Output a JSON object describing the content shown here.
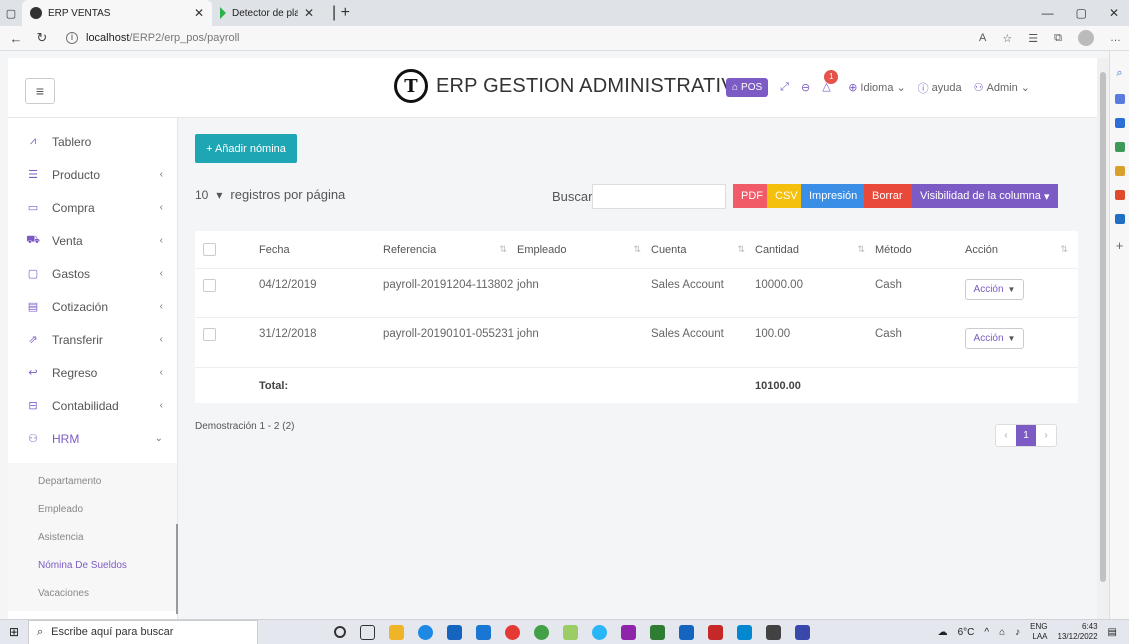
{
  "browser": {
    "tabs": [
      {
        "title": "ERP VENTAS",
        "active": true
      },
      {
        "title": "Detector de plagio -",
        "active": false
      }
    ],
    "url_host": "localhost",
    "url_path": "/ERP2/erp_pos/payroll"
  },
  "header": {
    "brand_title": "ERP GESTION ADMINISTRATIVA",
    "pos_label": "POS",
    "notif_count": "1",
    "language_label": "Idioma",
    "help_label": "ayuda",
    "user_label": "Admin"
  },
  "sidebar": {
    "items": [
      {
        "label": "Tablero",
        "icon": "dashboard-icon"
      },
      {
        "label": "Producto",
        "icon": "list-icon"
      },
      {
        "label": "Compra",
        "icon": "card-icon"
      },
      {
        "label": "Venta",
        "icon": "cart-icon"
      },
      {
        "label": "Gastos",
        "icon": "wallet-icon"
      },
      {
        "label": "Cotización",
        "icon": "document-icon"
      },
      {
        "label": "Transferir",
        "icon": "share-icon"
      },
      {
        "label": "Regreso",
        "icon": "return-icon"
      },
      {
        "label": "Contabilidad",
        "icon": "briefcase-icon"
      },
      {
        "label": "HRM",
        "icon": "users-icon"
      }
    ],
    "submenu": [
      "Departamento",
      "Empleado",
      "Asistencia",
      "Nómina De Sueldos",
      "Vacaciones"
    ],
    "active_sub": "Nómina De Sueldos"
  },
  "main": {
    "add_button": "+ Añadir nómina",
    "page_length": "10",
    "page_length_label": "registros por página",
    "search_label": "Buscar",
    "search_value": "",
    "buttons": {
      "pdf": "PDF",
      "csv": "CSV",
      "print": "Impresión",
      "delete": "Borrar",
      "columns": "Visibilidad de la columna"
    },
    "table": {
      "headers": [
        "Fecha",
        "Referencia",
        "Empleado",
        "Cuenta",
        "Cantidad",
        "Método",
        "Acción"
      ],
      "rows": [
        {
          "fecha": "04/12/2019",
          "referencia": "payroll-20191204-113802",
          "empleado": "john",
          "cuenta": "Sales Account",
          "cantidad": "10000.00",
          "metodo": "Cash",
          "accion": "Acción"
        },
        {
          "fecha": "31/12/2018",
          "referencia": "payroll-20190101-055231",
          "empleado": "john",
          "cuenta": "Sales Account",
          "cantidad": "100.00",
          "metodo": "Cash",
          "accion": "Acción"
        }
      ],
      "total_label": "Total:",
      "total_value": "10100.00"
    },
    "info": "Demostración 1 - 2 (2)",
    "pagination": {
      "prev": "‹",
      "current": "1",
      "next": "›"
    }
  },
  "taskbar": {
    "search_placeholder": "Escribe aquí para buscar",
    "weather": "6°C",
    "lang": "ENG",
    "lang2": "LAA",
    "time": "6:43",
    "date": "13/12/2022"
  },
  "colors": {
    "accent": "#7c5cc4",
    "add_button": "#1fa6b4",
    "pdf": "#f15b67",
    "csv": "#f5c00b",
    "print": "#3a8ee6",
    "delete": "#e8493b"
  }
}
